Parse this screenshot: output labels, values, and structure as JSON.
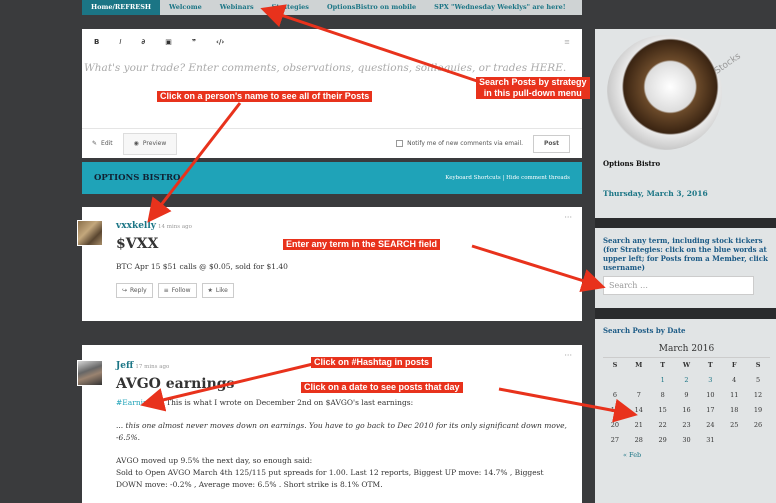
{
  "topnav": {
    "tabs": [
      {
        "label": "Home/REFRESH"
      },
      {
        "label": "Welcome"
      },
      {
        "label": "Webinars"
      },
      {
        "label": "Strategies"
      },
      {
        "label": "OptionsBistro on mobile"
      },
      {
        "label": "SPX \"Wednesday Weeklys\" are here!"
      }
    ]
  },
  "editor": {
    "placeholder": "What's your trade?  Enter comments, observations, questions, soliloquies, or trades HERE.",
    "edit_label": "Edit",
    "preview_label": "Preview",
    "notify_label": "Notify me of new comments via email.",
    "post_label": "Post"
  },
  "bistro_bar": {
    "title": "OPTIONS BISTRO",
    "links": "Keyboard Shortcuts | Hide comment threads"
  },
  "posts": [
    {
      "author": "vxxkelly",
      "time": "14 mins ago",
      "title": "$VXX",
      "body": "BTC Apr 15 $51 calls @ $0.05, sold for $1.40",
      "actions": [
        "Reply",
        "Follow",
        "Like"
      ]
    },
    {
      "author": "Jeff",
      "time": "17 mins ago",
      "title": "AVGO earnings",
      "hashtag": "#Earnings",
      "intro": "... This is what I wrote on December 2nd on $AVGO's last earnings:",
      "quote1": "... this one almost never moves down on earnings. You have to go back to Dec 2010 for its only significant down move,",
      "quote2": "-6.5%.",
      "line1": "AVGO moved up 9.5% the next day, so enough said:",
      "line2": "Sold to Open AVGO March 4th 125/115 put spreads for 1.00. Last 12 reports, Biggest UP move: 14.7% , Biggest",
      "line3": "DOWN move: -0.2% , Average move: 6.5% . Short strike is 8.1% OTM."
    }
  ],
  "sidebar": {
    "logo_text": "Options Bistro",
    "date": "Thursday, March 3, 2016",
    "search_info": "Search any term, including stock tickers (for Strategies: click on the blue words at upper left; for Posts from a Member, click username)",
    "search_placeholder": "Search …",
    "calendar_heading": "Search Posts by Date",
    "calendar_title": "March 2016",
    "weekdays": [
      "S",
      "M",
      "T",
      "W",
      "T",
      "F",
      "S"
    ],
    "prev": "« Feb"
  },
  "annotations": {
    "strategy": "Search Posts by strategy\nin this pull-down menu",
    "person": "Click on a person's name to see all of their Posts",
    "search": "Enter any term in the SEARCH field",
    "hashtag": "Click on #Hashtag in posts",
    "date": "Click on a date to see posts that day"
  },
  "colors": {
    "accent": "#1fa3b8",
    "link": "#1b7585",
    "annotation": "#e8321c"
  }
}
